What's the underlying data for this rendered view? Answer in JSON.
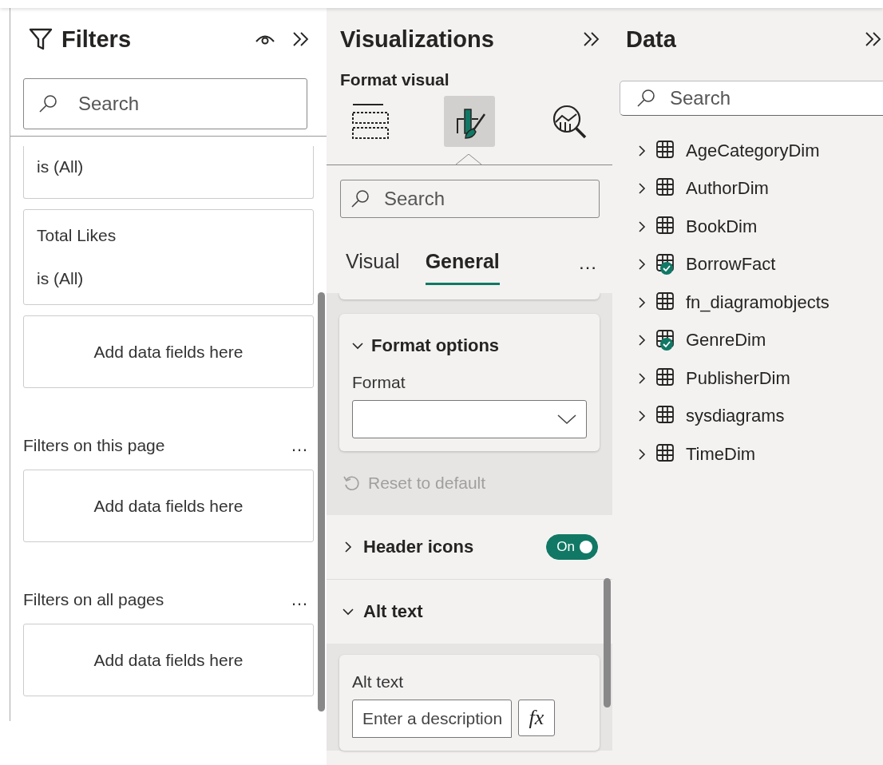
{
  "filters": {
    "title": "Filters",
    "search": {
      "placeholder": "Search"
    },
    "cards": [
      {
        "kind": "filter",
        "condition": "is (All)"
      },
      {
        "kind": "filter",
        "title": "Total Likes",
        "condition": "is (All)"
      },
      {
        "kind": "drop",
        "text": "Add data fields here"
      }
    ],
    "sections": [
      {
        "title": "Filters on this page",
        "more": "…",
        "drop": "Add data fields here"
      },
      {
        "title": "Filters on all pages",
        "more": "…",
        "drop": "Add data fields here"
      }
    ]
  },
  "visualizations": {
    "title": "Visualizations",
    "subtitle": "Format visual",
    "modes": [
      {
        "kind": "build",
        "selected": false
      },
      {
        "kind": "format",
        "selected": true
      },
      {
        "kind": "analytics",
        "selected": false
      }
    ],
    "search": {
      "placeholder": "Search"
    },
    "tabs": [
      {
        "label": "Visual",
        "selected": false
      },
      {
        "label": "General",
        "selected": true
      }
    ],
    "more": "…",
    "format_options": {
      "title": "Format options",
      "expanded": true,
      "field_label": "Format"
    },
    "reset": {
      "label": "Reset to default",
      "disabled": true
    },
    "header_icons": {
      "title": "Header icons",
      "expanded": false,
      "toggle": {
        "on": true,
        "label": "On"
      }
    },
    "alt_text": {
      "title": "Alt text",
      "expanded": true,
      "field_label": "Alt text",
      "placeholder": "Enter a description",
      "fx": "fx"
    }
  },
  "data": {
    "title": "Data",
    "search": {
      "placeholder": "Search"
    },
    "tables": [
      {
        "name": "AgeCategoryDim",
        "in_use": false
      },
      {
        "name": "AuthorDim",
        "in_use": false
      },
      {
        "name": "BookDim",
        "in_use": false
      },
      {
        "name": "BorrowFact",
        "in_use": true
      },
      {
        "name": "fn_diagramobjects",
        "in_use": false
      },
      {
        "name": "GenreDim",
        "in_use": true
      },
      {
        "name": "PublisherDim",
        "in_use": false
      },
      {
        "name": "sysdiagrams",
        "in_use": false
      },
      {
        "name": "TimeDim",
        "in_use": false
      }
    ]
  }
}
